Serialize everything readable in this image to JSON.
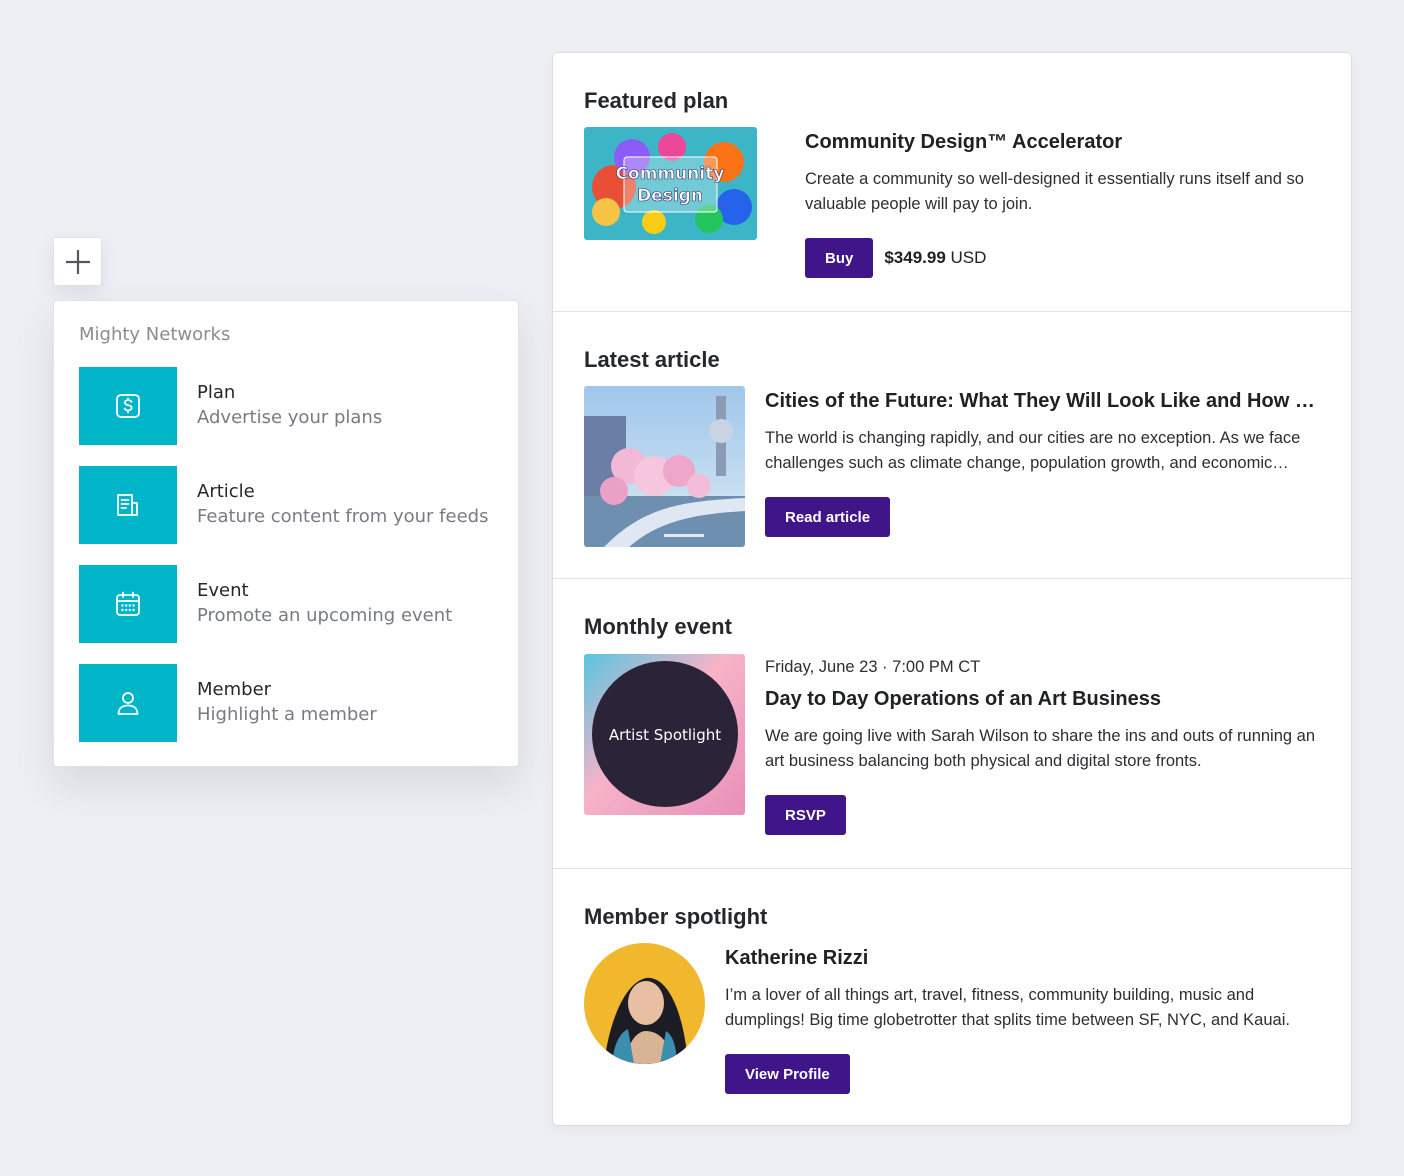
{
  "picker": {
    "title": "Mighty Networks",
    "items": [
      {
        "name": "Plan",
        "desc": "Advertise your plans",
        "icon": "dollar-icon"
      },
      {
        "name": "Article",
        "desc": "Feature content from your feeds",
        "icon": "article-icon"
      },
      {
        "name": "Event",
        "desc": "Promote an upcoming event",
        "icon": "calendar-icon"
      },
      {
        "name": "Member",
        "desc": "Highlight a member",
        "icon": "person-icon"
      }
    ]
  },
  "plan": {
    "section_title": "Featured plan",
    "thumb_text_line1": "Community",
    "thumb_text_line2": "Design",
    "title": "Community Design™ Accelerator",
    "desc": "Create a community so well-designed it essentially runs itself and so valuable people will pay to join.",
    "button": "Buy",
    "price_amount": "$349.99",
    "price_currency": "USD"
  },
  "article": {
    "section_title": "Latest article",
    "title": "Cities of the Future: What They Will Look Like and How They Will Work",
    "desc": "The world is changing rapidly, and our cities are no exception. As we face challenges such as climate change, population growth, and economic inequality, cities will need to adapt.",
    "button": "Read article"
  },
  "event": {
    "section_title": "Monthly event",
    "thumb_text": "Artist Spotlight",
    "date": "Friday, June 23 · 7:00 PM CT",
    "title": "Day to Day Operations of an Art Business",
    "desc": "We are going live with Sarah Wilson to share the ins and outs of running an art business balancing both physical and digital store fronts.",
    "button": "RSVP"
  },
  "member": {
    "section_title": "Member spotlight",
    "name": "Katherine Rizzi",
    "bio": "I’m a lover of all things art, travel, fitness, community building, music and dumplings! Big time globetrotter that splits time between SF, NYC, and Kauai.",
    "button": "View Profile"
  },
  "colors": {
    "accent": "#3f1589",
    "icon_tile": "#00b5c8",
    "background": "#eeeff4"
  }
}
